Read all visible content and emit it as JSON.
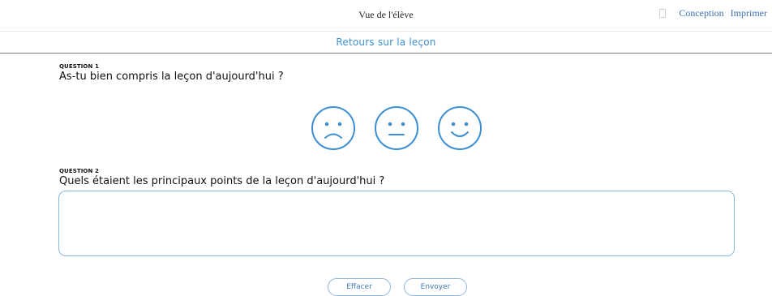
{
  "header": {
    "title": "Vue de l'élève",
    "links": [
      "Conception",
      "Imprimer"
    ]
  },
  "section": {
    "title": "Retours sur la leçon"
  },
  "questions": [
    {
      "label": "QUESTION 1",
      "text": "As-tu bien compris la leçon d'aujourd'hui ?"
    },
    {
      "label": "QUESTION 2",
      "text": "Quels étaient les principaux points de la leçon d'aujourd'hui ?"
    }
  ],
  "faces": [
    "sad-face-icon",
    "neutral-face-icon",
    "happy-face-icon"
  ],
  "answer": {
    "value": ""
  },
  "buttons": {
    "clear": "Effacer",
    "send": "Envoyer"
  },
  "colors": {
    "accent": "#3d8fd1",
    "link": "#3b6fb6",
    "border": "#88b9e3"
  }
}
